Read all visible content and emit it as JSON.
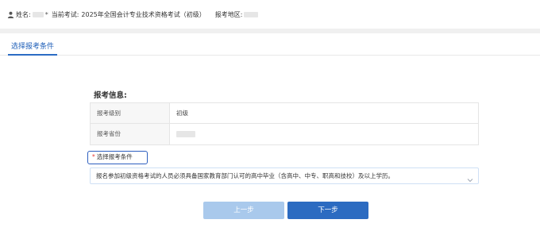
{
  "topbar": {
    "name_label": "姓名:",
    "exam_label": "当前考试:",
    "exam_name": "2025年全国会计专业技术资格考试（初级）",
    "region_label": "报考地区:"
  },
  "tabs": [
    {
      "label": "选择报考条件",
      "active": true
    }
  ],
  "section": {
    "title": "报考信息:"
  },
  "info_rows": [
    {
      "label": "报考级别",
      "value": "初级"
    },
    {
      "label": "报考省份",
      "value": ""
    }
  ],
  "condition": {
    "required_mark": "*",
    "label": "选择报考条件",
    "selected": "报名参加初级资格考试的人员必须具备国家教育部门认可的高中毕业（含高中、中专、职高和技校）及以上学历。"
  },
  "buttons": {
    "prev_label": "上一步",
    "next_label": "下一步"
  },
  "colors": {
    "accent": "#2c6bc1",
    "accent_light": "#a9c9ec",
    "required": "#e53935"
  },
  "icons": {
    "user": "user-icon",
    "chevron": "chevron-down-icon"
  }
}
